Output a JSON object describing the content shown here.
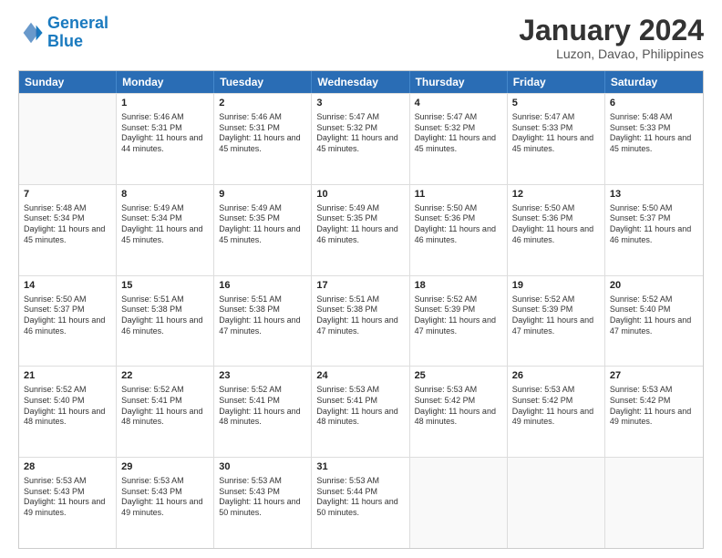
{
  "header": {
    "logo_line1": "General",
    "logo_line2": "Blue",
    "title": "January 2024",
    "subtitle": "Luzon, Davao, Philippines"
  },
  "calendar": {
    "days": [
      "Sunday",
      "Monday",
      "Tuesday",
      "Wednesday",
      "Thursday",
      "Friday",
      "Saturday"
    ],
    "rows": [
      [
        {
          "day": "",
          "empty": true
        },
        {
          "day": "1",
          "sunrise": "5:46 AM",
          "sunset": "5:31 PM",
          "daylight": "11 hours and 44 minutes."
        },
        {
          "day": "2",
          "sunrise": "5:46 AM",
          "sunset": "5:31 PM",
          "daylight": "11 hours and 45 minutes."
        },
        {
          "day": "3",
          "sunrise": "5:47 AM",
          "sunset": "5:32 PM",
          "daylight": "11 hours and 45 minutes."
        },
        {
          "day": "4",
          "sunrise": "5:47 AM",
          "sunset": "5:32 PM",
          "daylight": "11 hours and 45 minutes."
        },
        {
          "day": "5",
          "sunrise": "5:47 AM",
          "sunset": "5:33 PM",
          "daylight": "11 hours and 45 minutes."
        },
        {
          "day": "6",
          "sunrise": "5:48 AM",
          "sunset": "5:33 PM",
          "daylight": "11 hours and 45 minutes."
        }
      ],
      [
        {
          "day": "7",
          "sunrise": "5:48 AM",
          "sunset": "5:34 PM",
          "daylight": "11 hours and 45 minutes."
        },
        {
          "day": "8",
          "sunrise": "5:49 AM",
          "sunset": "5:34 PM",
          "daylight": "11 hours and 45 minutes."
        },
        {
          "day": "9",
          "sunrise": "5:49 AM",
          "sunset": "5:35 PM",
          "daylight": "11 hours and 45 minutes."
        },
        {
          "day": "10",
          "sunrise": "5:49 AM",
          "sunset": "5:35 PM",
          "daylight": "11 hours and 46 minutes."
        },
        {
          "day": "11",
          "sunrise": "5:50 AM",
          "sunset": "5:36 PM",
          "daylight": "11 hours and 46 minutes."
        },
        {
          "day": "12",
          "sunrise": "5:50 AM",
          "sunset": "5:36 PM",
          "daylight": "11 hours and 46 minutes."
        },
        {
          "day": "13",
          "sunrise": "5:50 AM",
          "sunset": "5:37 PM",
          "daylight": "11 hours and 46 minutes."
        }
      ],
      [
        {
          "day": "14",
          "sunrise": "5:50 AM",
          "sunset": "5:37 PM",
          "daylight": "11 hours and 46 minutes."
        },
        {
          "day": "15",
          "sunrise": "5:51 AM",
          "sunset": "5:38 PM",
          "daylight": "11 hours and 46 minutes."
        },
        {
          "day": "16",
          "sunrise": "5:51 AM",
          "sunset": "5:38 PM",
          "daylight": "11 hours and 47 minutes."
        },
        {
          "day": "17",
          "sunrise": "5:51 AM",
          "sunset": "5:38 PM",
          "daylight": "11 hours and 47 minutes."
        },
        {
          "day": "18",
          "sunrise": "5:52 AM",
          "sunset": "5:39 PM",
          "daylight": "11 hours and 47 minutes."
        },
        {
          "day": "19",
          "sunrise": "5:52 AM",
          "sunset": "5:39 PM",
          "daylight": "11 hours and 47 minutes."
        },
        {
          "day": "20",
          "sunrise": "5:52 AM",
          "sunset": "5:40 PM",
          "daylight": "11 hours and 47 minutes."
        }
      ],
      [
        {
          "day": "21",
          "sunrise": "5:52 AM",
          "sunset": "5:40 PM",
          "daylight": "11 hours and 48 minutes."
        },
        {
          "day": "22",
          "sunrise": "5:52 AM",
          "sunset": "5:41 PM",
          "daylight": "11 hours and 48 minutes."
        },
        {
          "day": "23",
          "sunrise": "5:52 AM",
          "sunset": "5:41 PM",
          "daylight": "11 hours and 48 minutes."
        },
        {
          "day": "24",
          "sunrise": "5:53 AM",
          "sunset": "5:41 PM",
          "daylight": "11 hours and 48 minutes."
        },
        {
          "day": "25",
          "sunrise": "5:53 AM",
          "sunset": "5:42 PM",
          "daylight": "11 hours and 48 minutes."
        },
        {
          "day": "26",
          "sunrise": "5:53 AM",
          "sunset": "5:42 PM",
          "daylight": "11 hours and 49 minutes."
        },
        {
          "day": "27",
          "sunrise": "5:53 AM",
          "sunset": "5:42 PM",
          "daylight": "11 hours and 49 minutes."
        }
      ],
      [
        {
          "day": "28",
          "sunrise": "5:53 AM",
          "sunset": "5:43 PM",
          "daylight": "11 hours and 49 minutes."
        },
        {
          "day": "29",
          "sunrise": "5:53 AM",
          "sunset": "5:43 PM",
          "daylight": "11 hours and 49 minutes."
        },
        {
          "day": "30",
          "sunrise": "5:53 AM",
          "sunset": "5:43 PM",
          "daylight": "11 hours and 50 minutes."
        },
        {
          "day": "31",
          "sunrise": "5:53 AM",
          "sunset": "5:44 PM",
          "daylight": "11 hours and 50 minutes."
        },
        {
          "day": "",
          "empty": true
        },
        {
          "day": "",
          "empty": true
        },
        {
          "day": "",
          "empty": true
        }
      ]
    ]
  }
}
